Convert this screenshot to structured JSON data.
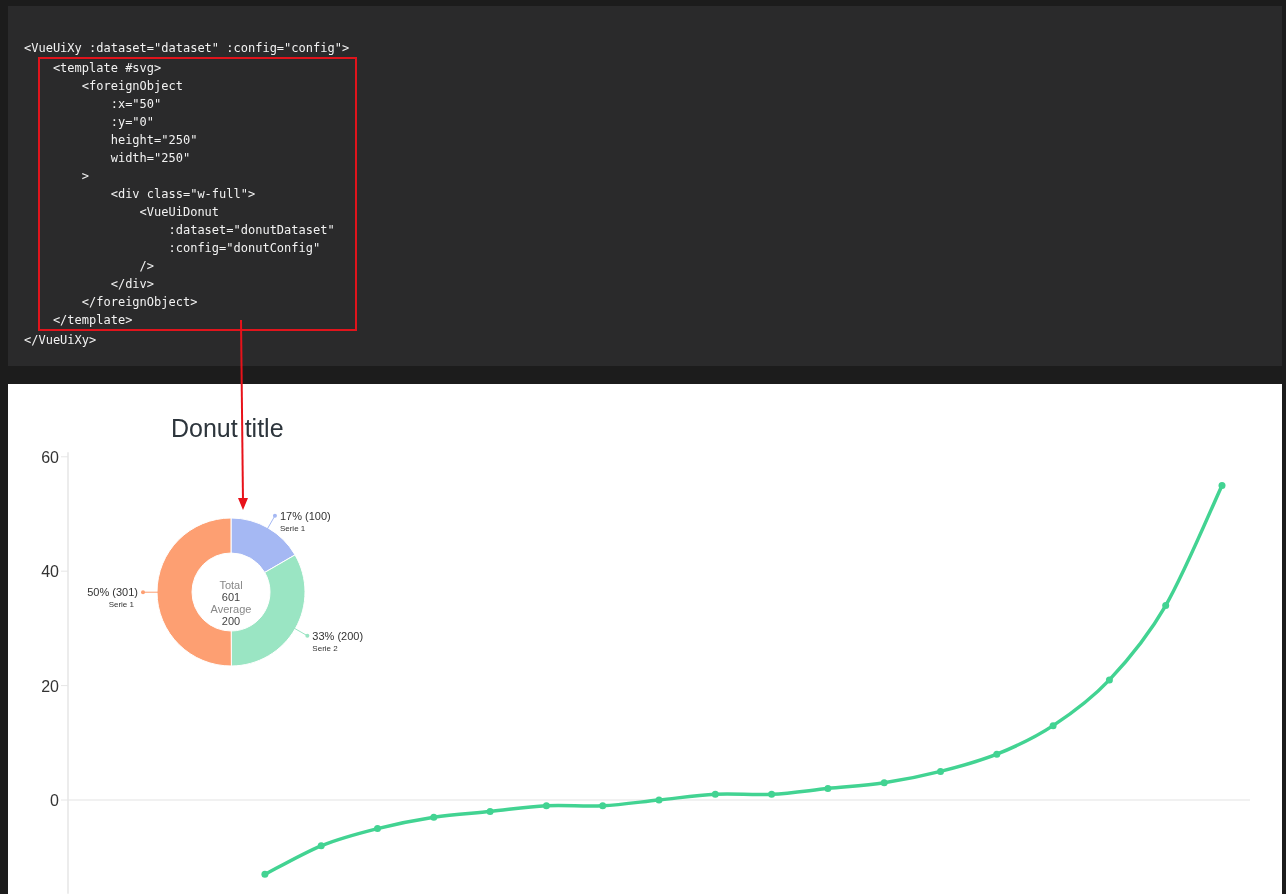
{
  "code_panel": {
    "blocks": [
      {
        "highlighted": false,
        "lines": [
          "<VueUiXy :dataset=\"dataset\" :config=\"config\">"
        ]
      },
      {
        "highlighted": true,
        "lines": [
          "    <template #svg>",
          "        <foreignObject",
          "            :x=\"50\"",
          "            :y=\"0\"",
          "            height=\"250\"",
          "            width=\"250\"",
          "        >",
          "            <div class=\"w-full\">",
          "                <VueUiDonut",
          "                    :dataset=\"donutDataset\"",
          "                    :config=\"donutConfig\"",
          "                />",
          "            </div>",
          "        </foreignObject>",
          "    </template>"
        ]
      },
      {
        "highlighted": false,
        "lines": [
          "</VueUiXy>"
        ]
      }
    ]
  },
  "line_chart": {
    "chart_data": {
      "type": "line",
      "ylim": [
        -16.4,
        60.8
      ],
      "yticks": [
        0,
        20,
        40,
        60
      ],
      "series": [
        {
          "color": "#42d392",
          "marker": true,
          "values": [
            null,
            null,
            null,
            -13,
            -8,
            -5,
            -3,
            -2,
            -1,
            -1,
            0,
            1,
            1,
            2,
            3,
            5,
            8,
            13,
            21,
            34,
            55
          ]
        }
      ]
    }
  },
  "donut": {
    "chart_data": {
      "type": "donut",
      "title": "Donut title",
      "categories": [
        "Serie 1",
        "Serie 2",
        "Serie 1"
      ],
      "values": [
        100,
        200,
        301
      ],
      "colors": [
        "#a5b8f3",
        "#9ae5c3",
        "#fd9f72"
      ],
      "value_labels": [
        "17% (100)",
        "33% (200)",
        "50% (301)"
      ]
    },
    "center": {
      "total_label": "Total",
      "total": "601",
      "average_label": "Average",
      "average": "200"
    }
  }
}
